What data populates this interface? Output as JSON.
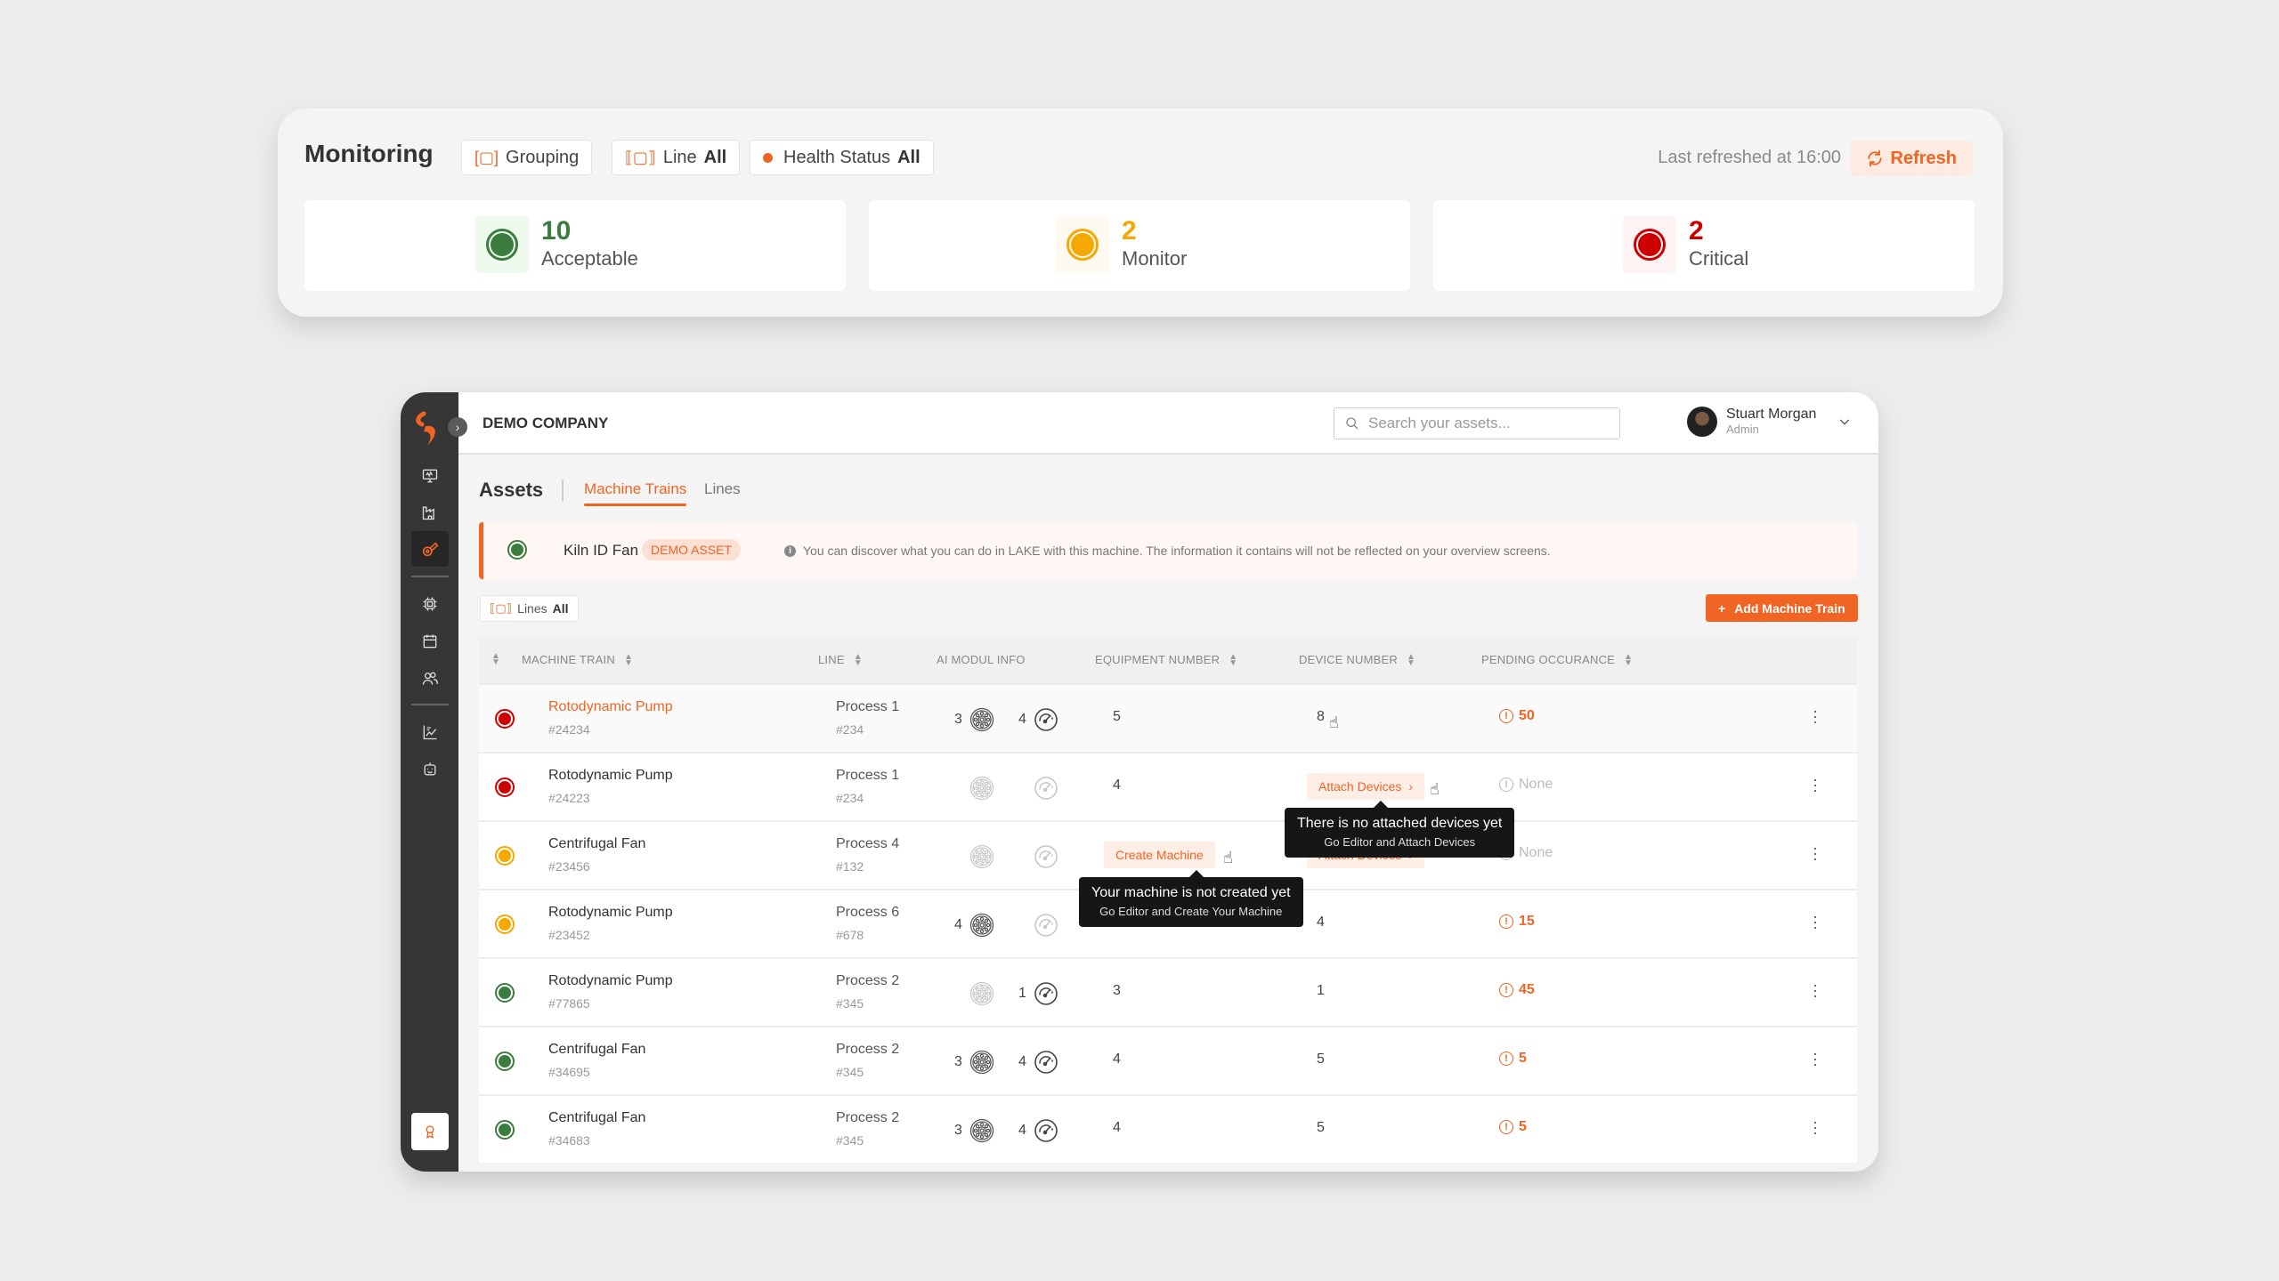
{
  "monitoring": {
    "title": "Monitoring",
    "filters": {
      "grouping": "Grouping",
      "line_label": "Line",
      "line_value": "All",
      "health_label": "Health Status",
      "health_value": "All"
    },
    "last_refreshed": "Last refreshed at 16:00",
    "refresh_label": "Refresh",
    "stats": [
      {
        "count": "10",
        "label": "Acceptable",
        "color": "#3a7d3f"
      },
      {
        "count": "2",
        "label": "Monitor",
        "color": "#f5a800"
      },
      {
        "count": "2",
        "label": "Critical",
        "color": "#cc0000"
      }
    ]
  },
  "app": {
    "company": "DEMO COMPANY",
    "search_placeholder": "Search your assets...",
    "user": {
      "name": "Stuart Morgan",
      "role": "Admin"
    },
    "sidebar": {
      "items": [
        "monitor-icon",
        "factory-icon",
        "machine-train-icon",
        "devices-icon",
        "calendar-icon",
        "users-icon",
        "analytics-icon",
        "robot-icon"
      ],
      "active": "machine-train-icon",
      "bottom": "award-icon"
    },
    "page_title": "Assets",
    "tabs": [
      {
        "label": "Machine Trains",
        "active": true
      },
      {
        "label": "Lines",
        "active": false
      }
    ],
    "demo_banner": {
      "name": "Kiln ID Fan",
      "badge": "DEMO ASSET",
      "info": "You can discover what you can do in LAKE with this machine. The information it contains will not be reflected on your overview screens."
    },
    "lines_filter": {
      "label": "Lines",
      "value": "All"
    },
    "add_button": "Add Machine Train",
    "table": {
      "headers": [
        "MACHINE TRAIN",
        "LINE",
        "AI MODUL INFO",
        "EQUIPMENT NUMBER",
        "DEVICE NUMBER",
        "PENDING OCCURANCE"
      ],
      "rows": [
        {
          "status": "critical",
          "name": "Rotodynamic Pump",
          "id": "#24234",
          "line": "Process 1",
          "line_id": "#234",
          "ai_bearing": "3",
          "ai_gauge": "4",
          "equipment": "5",
          "devices": "8",
          "pending": "50",
          "highlight": true
        },
        {
          "status": "critical",
          "name": "Rotodynamic Pump",
          "id": "#24223",
          "line": "Process 1",
          "line_id": "#234",
          "ai_bearing": "",
          "ai_gauge": "",
          "equipment": "4",
          "devices_action": "Attach Devices",
          "pending": "None"
        },
        {
          "status": "monitor",
          "name": "Centrifugal Fan",
          "id": "#23456",
          "line": "Process 4",
          "line_id": "#132",
          "ai_bearing": "",
          "ai_gauge": "",
          "equipment_action": "Create Machine",
          "devices_action": "Attach Devices",
          "pending": "None"
        },
        {
          "status": "monitor",
          "name": "Rotodynamic Pump",
          "id": "#23452",
          "line": "Process 6",
          "line_id": "#678",
          "ai_bearing": "4",
          "ai_gauge": "",
          "equipment": "",
          "devices": "4",
          "pending": "15"
        },
        {
          "status": "acceptable",
          "name": "Rotodynamic Pump",
          "id": "#77865",
          "line": "Process 2",
          "line_id": "#345",
          "ai_bearing": "",
          "ai_gauge": "1",
          "equipment": "3",
          "devices": "1",
          "pending": "45"
        },
        {
          "status": "acceptable",
          "name": "Centrifugal Fan",
          "id": "#34695",
          "line": "Process 2",
          "line_id": "#345",
          "ai_bearing": "3",
          "ai_gauge": "4",
          "equipment": "4",
          "devices": "5",
          "pending": "5"
        },
        {
          "status": "acceptable",
          "name": "Centrifugal Fan",
          "id": "#34683",
          "line": "Process 2",
          "line_id": "#345",
          "ai_bearing": "3",
          "ai_gauge": "4",
          "equipment": "4",
          "devices": "5",
          "pending": "5"
        }
      ]
    },
    "tooltips": {
      "attach": {
        "title": "There is no attached devices yet",
        "subtitle": "Go Editor and Attach Devices"
      },
      "create": {
        "title": "Your machine is not created yet",
        "subtitle": "Go Editor and Create Your Machine"
      }
    },
    "colors": {
      "accent": "#f06424",
      "acceptable": "#3a7d3f",
      "monitor": "#f5a800",
      "critical": "#cc0000"
    }
  }
}
